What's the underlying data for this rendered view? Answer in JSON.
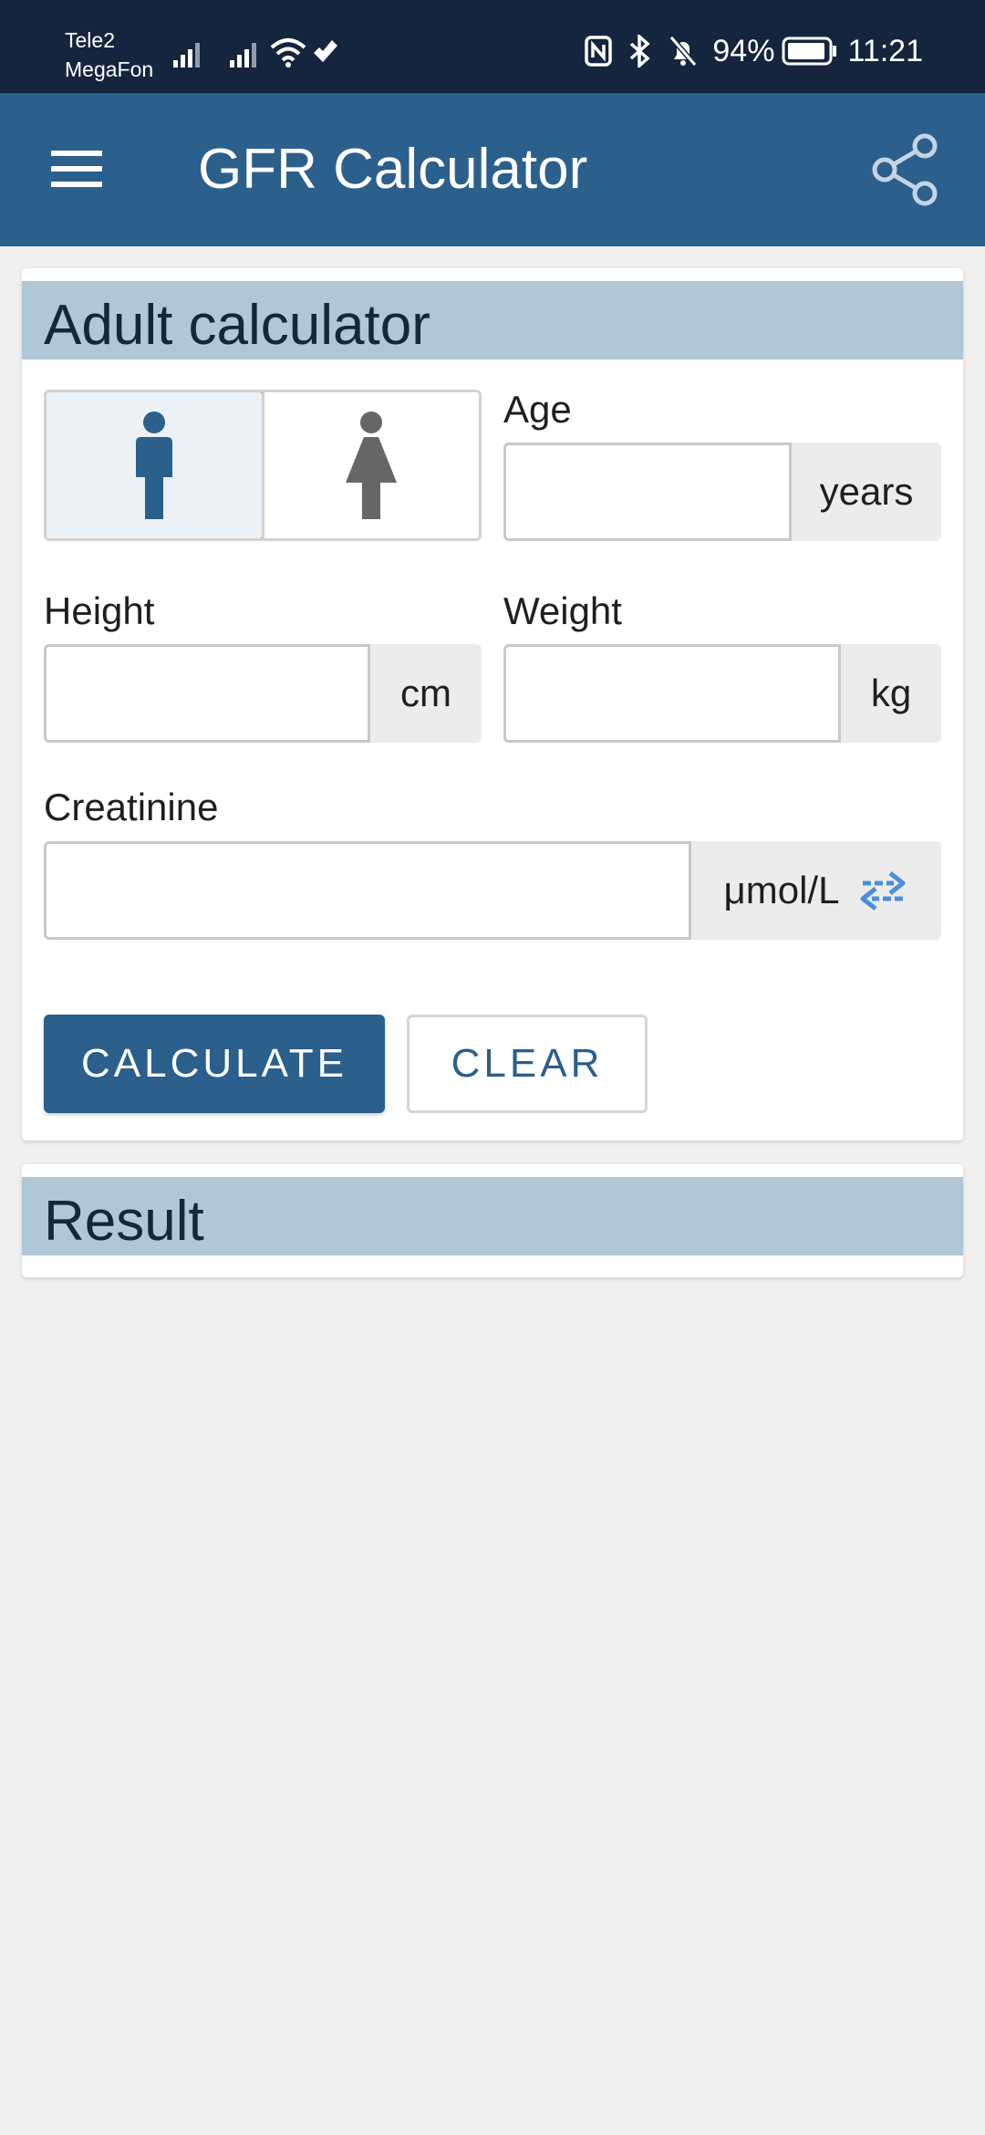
{
  "status_bar": {
    "carrier_1": "Tele2",
    "carrier_2": "MegaFon",
    "battery": "94%",
    "time": "11:21"
  },
  "app_bar": {
    "title": "GFR Calculator",
    "menu_icon": "hamburger-menu-icon",
    "share_icon": "share-icon"
  },
  "calculator": {
    "header": "Adult calculator",
    "gender": {
      "selected": "male",
      "options": [
        "male",
        "female"
      ]
    },
    "age": {
      "label": "Age",
      "value": "",
      "unit": "years"
    },
    "height": {
      "label": "Height",
      "value": "",
      "unit": "cm"
    },
    "weight": {
      "label": "Weight",
      "value": "",
      "unit": "kg"
    },
    "creatinine": {
      "label": "Creatinine",
      "value": "",
      "unit": "μmol/L",
      "unit_icon": "swap-arrows-icon"
    },
    "calculate_label": "CALCULATE",
    "clear_label": "CLEAR"
  },
  "result": {
    "header": "Result"
  },
  "colors": {
    "status_bar": "#14253d",
    "app_bar": "#2b5f8c",
    "card_header": "#afc7d6",
    "accent": "#2b5f8c",
    "swap_icon": "#4a8fdc",
    "background": "#f1f0ee"
  }
}
